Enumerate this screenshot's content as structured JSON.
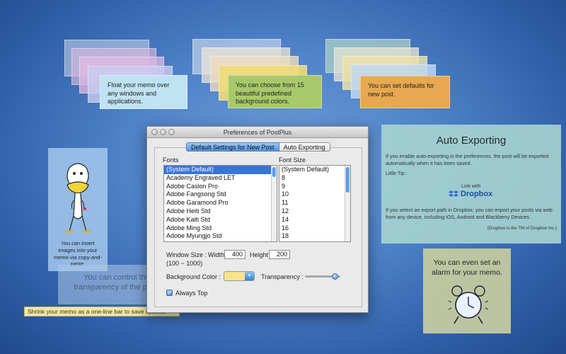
{
  "fans": [
    {
      "text": "Float your memo over any windows and applications.",
      "top_color": "#bfe3f2"
    },
    {
      "text": "You can choose from 15 beautiful predefined background colors.",
      "top_color": "#a8c96a"
    },
    {
      "text": "You can set defaults for new post.",
      "top_color": "#e7a84f"
    }
  ],
  "left_memo": {
    "text": "You can insert images into your memo via copy-and-paste."
  },
  "transparency_memo": {
    "text": "You can control the transparency of the post."
  },
  "bar_memo": {
    "text": "Shrink your memo as a one-line bar to save spaces."
  },
  "auto_export": {
    "title": "Auto Exporting",
    "para1": "If you enable auto-exporting in the preferences, the post will be exported automatically when it has been saved.",
    "tip_label": "Little Tip :",
    "link_with": "Link with",
    "dropbox": "Dropbox",
    "para2": "If you select an export path in Dropbox, you can import your posts via web from any device, including iOS, Android and Blackberry Devices.",
    "trademark": "(Dropbox is the TM of Dropbox Inc.)"
  },
  "alarm_memo": {
    "text": "You can even set an alarm for your memo."
  },
  "window": {
    "title": "Preferences of PostPlus",
    "tabs": [
      "Default Settings for New Post",
      "Auto Exporting"
    ],
    "fonts_label": "Fonts",
    "font_size_label": "Font Size",
    "fonts": [
      "(System Default)",
      "Academy Engraved LET",
      "Adobe Caslon Pro",
      "Adobe Fangsong Std",
      "Adobe Garamond Pro",
      "Adobe Heiti Std",
      "Adobe Kaiti Std",
      "Adobe Ming Std",
      "Adobe Myungjo Std"
    ],
    "sizes": [
      "(System Default)",
      "8",
      "9",
      "10",
      "11",
      "12",
      "14",
      "16",
      "18"
    ],
    "window_size_label": "Window Size :",
    "width_label": "Width",
    "width_value": "400",
    "height_label": "Height",
    "height_value": "200",
    "range_note": "(100 ~ 1000)",
    "bg_color_label": "Background Color :",
    "bg_color": "#f6e48a",
    "transparency_label": "Transparency :",
    "transparency_level": 0.85,
    "always_top_label": "Always Top",
    "always_top_checked": true
  }
}
